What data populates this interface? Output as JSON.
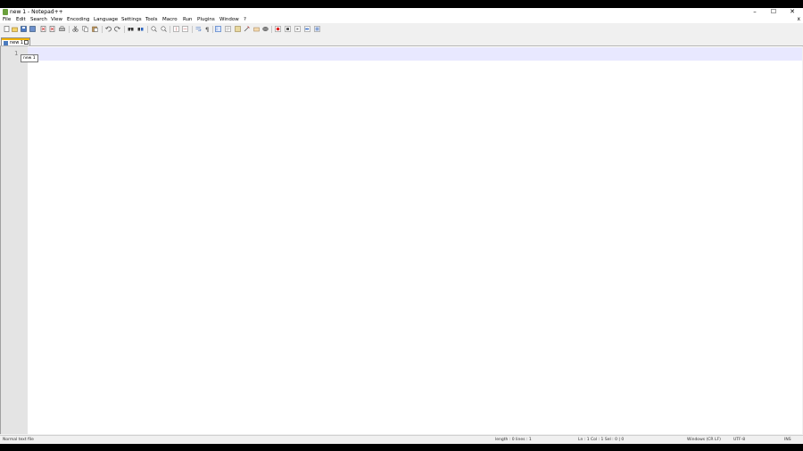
{
  "window": {
    "title": "new 1 - Notepad++",
    "controls": {
      "minimize": "–",
      "maximize": "☐",
      "close": "✕"
    }
  },
  "menu": {
    "items": [
      "File",
      "Edit",
      "Search",
      "View",
      "Encoding",
      "Language",
      "Settings",
      "Tools",
      "Macro",
      "Run",
      "Plugins",
      "Window",
      "?"
    ],
    "doc_close": "x"
  },
  "toolbar": {
    "buttons": [
      "new-icon",
      "open-icon",
      "save-icon",
      "save-all-icon",
      "close-icon",
      "close-all-icon",
      "print-icon",
      "cut-icon",
      "copy-icon",
      "paste-icon",
      "undo-icon",
      "redo-icon",
      "find-icon",
      "replace-icon",
      "zoom-in-icon",
      "zoom-out-icon",
      "sync-vertical-icon",
      "sync-horizontal-icon",
      "word-wrap-icon",
      "show-all-chars-icon",
      "indent-guide-icon",
      "udl-icon",
      "doc-map-icon",
      "function-list-icon",
      "folder-as-workspace-icon",
      "monitoring-icon",
      "macro-record-icon",
      "macro-stop-icon",
      "macro-play-icon",
      "macro-play-multiple-icon",
      "macro-save-icon"
    ]
  },
  "tab": {
    "label": "new 1",
    "tooltip": "new 1"
  },
  "editor": {
    "line_number": "1"
  },
  "status": {
    "file_type": "Normal text file",
    "length_lines": "length : 0    lines : 1",
    "position": "Ln : 1    Col : 1    Sel : 0 | 0",
    "eol": "Windows (CR LF)",
    "encoding": "UTF-8",
    "mode": "INS"
  }
}
